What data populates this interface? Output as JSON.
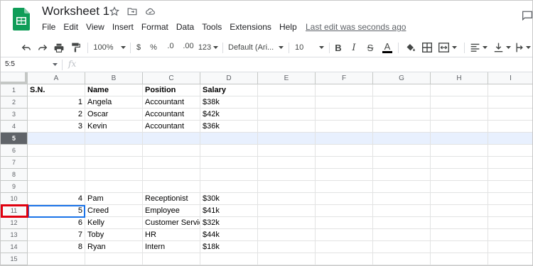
{
  "doc": {
    "title": "Worksheet 1",
    "last_edit": "Last edit was seconds ago"
  },
  "menu": [
    "File",
    "Edit",
    "View",
    "Insert",
    "Format",
    "Data",
    "Tools",
    "Extensions",
    "Help"
  ],
  "toolbar": {
    "zoom": "100%",
    "currency": "$",
    "percent": "%",
    "decrease_decimal": ".0",
    "increase_decimal": ".00",
    "more_formats": "123",
    "font": "Default (Ari...",
    "font_size": "10",
    "bold": "B",
    "italic": "I",
    "strike": "S",
    "text_color": "A"
  },
  "formula_bar": {
    "name_box": "5:5",
    "fx": "fx"
  },
  "columns": [
    "A",
    "B",
    "C",
    "D",
    "E",
    "F",
    "G",
    "H",
    "I"
  ],
  "rows": [
    {
      "n": "1",
      "cells": [
        "S.N.",
        "Name",
        "Position",
        "Salary"
      ]
    },
    {
      "n": "2",
      "cells": [
        "1",
        "Angela",
        "Accountant",
        "$38k"
      ]
    },
    {
      "n": "3",
      "cells": [
        "2",
        "Oscar",
        "Accountant",
        "$42k"
      ]
    },
    {
      "n": "4",
      "cells": [
        "3",
        "Kevin",
        "Accountant",
        "$36k"
      ]
    },
    {
      "n": "5",
      "cells": [
        "",
        "",
        "",
        ""
      ]
    },
    {
      "n": "6",
      "cells": [
        "",
        "",
        "",
        ""
      ]
    },
    {
      "n": "7",
      "cells": [
        "",
        "",
        "",
        ""
      ]
    },
    {
      "n": "8",
      "cells": [
        "",
        "",
        "",
        ""
      ]
    },
    {
      "n": "9",
      "cells": [
        "",
        "",
        "",
        ""
      ]
    },
    {
      "n": "10",
      "cells": [
        "4",
        "Pam",
        "Receptionist",
        "$30k"
      ]
    },
    {
      "n": "11",
      "cells": [
        "5",
        "Creed",
        "Employee",
        "$41k"
      ]
    },
    {
      "n": "12",
      "cells": [
        "6",
        "Kelly",
        "Customer Servic",
        "$32k"
      ]
    },
    {
      "n": "13",
      "cells": [
        "7",
        "Toby",
        "HR",
        "$44k"
      ]
    },
    {
      "n": "14",
      "cells": [
        "8",
        "Ryan",
        "Intern",
        "$18k"
      ]
    },
    {
      "n": "15",
      "cells": [
        "",
        "",
        "",
        ""
      ]
    }
  ],
  "selected_row": "5",
  "colors": {
    "sheets_green": "#0f9d58",
    "selection_blue": "#1a73e8",
    "highlight_red": "#e0000f"
  }
}
